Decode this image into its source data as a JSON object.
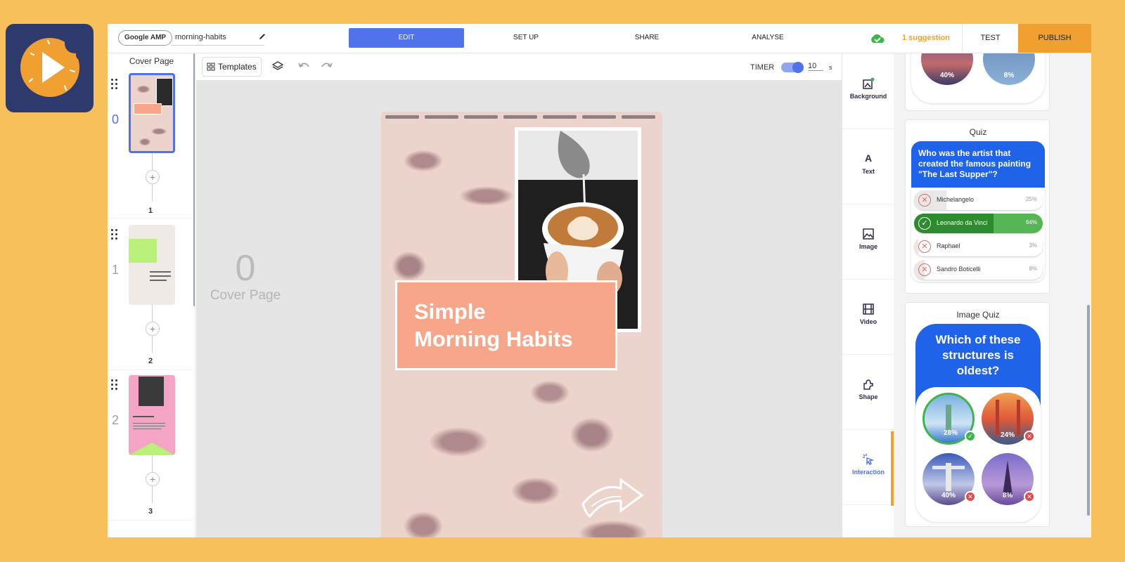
{
  "topbar": {
    "badge": "Google AMP",
    "story_name": "morning-habits",
    "tabs": [
      {
        "label": "EDIT",
        "active": true
      },
      {
        "label": "SET UP"
      },
      {
        "label": "SHARE"
      },
      {
        "label": "ANALYSE"
      }
    ],
    "suggestion": "1 suggestion",
    "test": "TEST",
    "publish": "PUBLISH"
  },
  "pages": {
    "title": "Cover Page",
    "items": [
      {
        "index": "0",
        "label": "1"
      },
      {
        "index": "1",
        "label": "2"
      },
      {
        "index": "2",
        "label": "3"
      }
    ]
  },
  "toolbar": {
    "templates": "Templates",
    "timer_label": "TIMER",
    "timer_value": "10",
    "timer_unit": "s"
  },
  "canvas": {
    "page_index": "0",
    "page_label": "Cover Page",
    "title_line1": "Simple",
    "title_line2": "Morning Habits"
  },
  "tools": [
    {
      "label": "Background",
      "icon": "background-icon"
    },
    {
      "label": "Text",
      "icon": "text-icon"
    },
    {
      "label": "Image",
      "icon": "image-icon"
    },
    {
      "label": "Video",
      "icon": "video-icon"
    },
    {
      "label": "Shape",
      "icon": "shape-icon"
    },
    {
      "label": "Interaction",
      "icon": "interaction-icon",
      "active": true
    }
  ],
  "right_panel": {
    "top_card": {
      "left_pct": "40%",
      "right_pct": "8%"
    },
    "quiz": {
      "title": "Quiz",
      "question": "Who was the artist that created the famous painting \"The Last Supper\"?",
      "options": [
        {
          "text": "Michelangelo",
          "pct": "25%",
          "correct": false
        },
        {
          "text": "Leonardo da Vinci",
          "pct": "64%",
          "correct": true
        },
        {
          "text": "Raphael",
          "pct": "3%",
          "correct": false
        },
        {
          "text": "Sandro Boticelli",
          "pct": "8%",
          "correct": false
        }
      ]
    },
    "image_quiz": {
      "title": "Image Quiz",
      "question": "Which of these structures is oldest?",
      "options": [
        {
          "pct": "28%",
          "correct": true
        },
        {
          "pct": "24%",
          "correct": false
        },
        {
          "pct": "40%",
          "correct": false
        },
        {
          "pct": "8%",
          "correct": false
        }
      ]
    }
  },
  "colors": {
    "background": "#f8c05a",
    "accent": "#5072ea",
    "publish": "#f0a030",
    "story_title_box": "#f7a68a",
    "quiz_blue": "#1e63e9"
  }
}
